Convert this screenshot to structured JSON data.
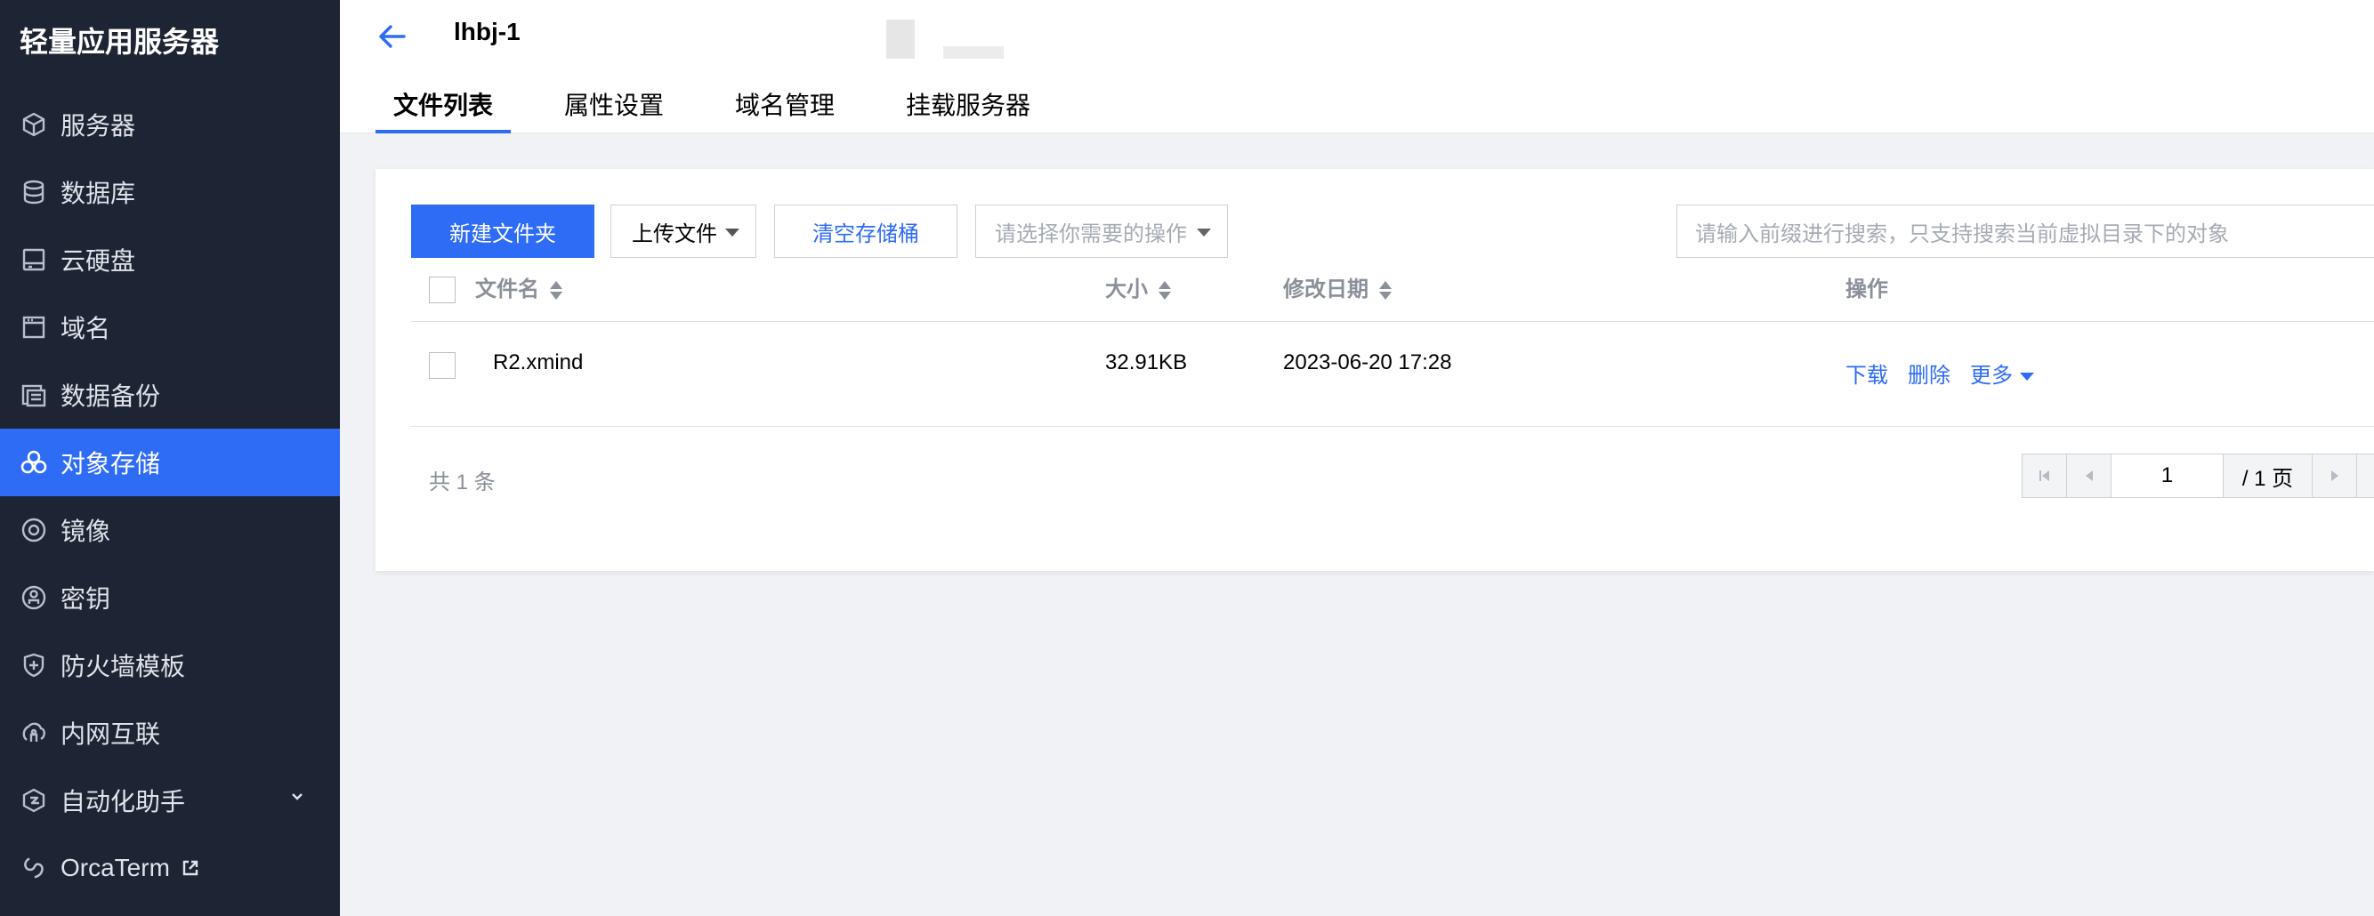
{
  "sidebar": {
    "brand": "轻量应用服务器",
    "items": [
      {
        "label": "服务器",
        "icon": "cube-icon"
      },
      {
        "label": "数据库",
        "icon": "database-icon"
      },
      {
        "label": "云硬盘",
        "icon": "disk-icon"
      },
      {
        "label": "域名",
        "icon": "browser-window-icon"
      },
      {
        "label": "数据备份",
        "icon": "backup-icon"
      },
      {
        "label": "对象存储",
        "icon": "object-storage-icon",
        "active": true
      },
      {
        "label": "镜像",
        "icon": "image-disc-icon"
      },
      {
        "label": "密钥",
        "icon": "key-icon"
      },
      {
        "label": "防火墙模板",
        "icon": "shield-icon"
      },
      {
        "label": "内网互联",
        "icon": "network-link-icon"
      },
      {
        "label": "自动化助手",
        "icon": "automation-icon",
        "has_chevron": true
      },
      {
        "label": "OrcaTerm",
        "icon": "orcaterm-icon",
        "external": true
      }
    ]
  },
  "header": {
    "title": "lhbj-1",
    "tabs": [
      "文件列表",
      "属性设置",
      "域名管理",
      "挂载服务器"
    ],
    "active_tab": 0
  },
  "toolbar": {
    "new_folder": "新建文件夹",
    "upload": "上传文件",
    "clear_bucket": "清空存储桶",
    "ops_placeholder": "请选择你需要的操作",
    "search_placeholder": "请输入前缀进行搜索，只支持搜索当前虚拟目录下的对象"
  },
  "table": {
    "columns": {
      "name": "文件名",
      "size": "大小",
      "modified": "修改日期",
      "actions": "操作"
    },
    "rows": [
      {
        "name": "R2.xmind",
        "size": "32.91KB",
        "modified": "2023-06-20 17:28",
        "download": "下载",
        "delete": "删除",
        "more": "更多"
      }
    ]
  },
  "pagination": {
    "total_label": "共 1 条",
    "current_page": "1",
    "total_pages_label": "/ 1 页"
  },
  "colors": {
    "sidebar_bg": "#1d2433",
    "accent": "#2e6cf6",
    "page_bg": "#f0f2f5"
  }
}
